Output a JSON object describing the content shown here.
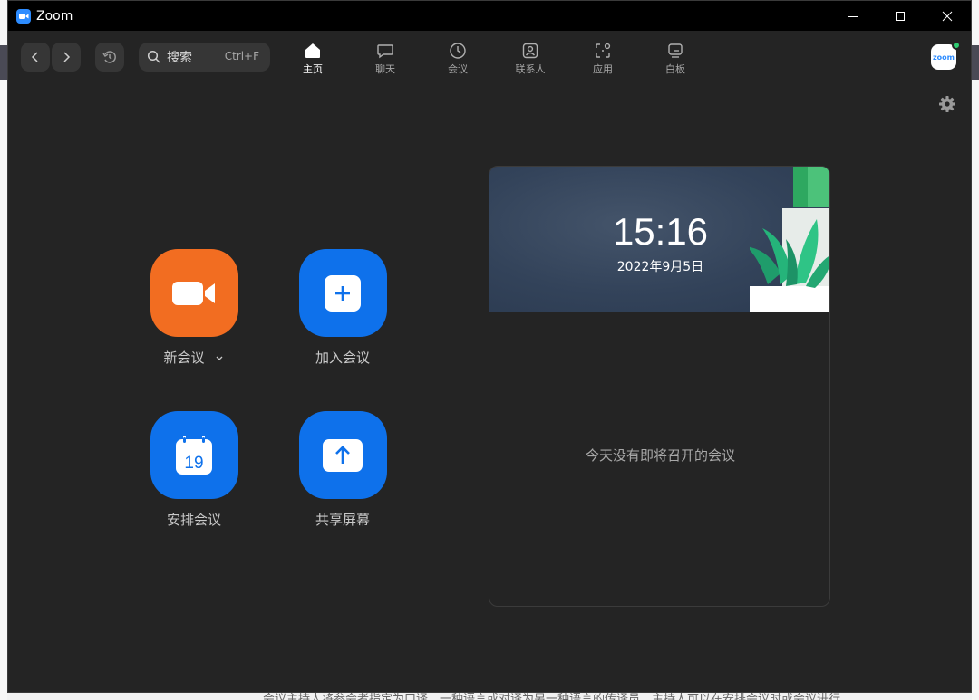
{
  "app": {
    "title": "Zoom"
  },
  "search": {
    "label": "搜索",
    "shortcut": "Ctrl+F"
  },
  "tabs": [
    {
      "label": "主页",
      "icon": "home-icon",
      "active": true
    },
    {
      "label": "聊天",
      "icon": "chat-icon",
      "active": false
    },
    {
      "label": "会议",
      "icon": "clock-icon",
      "active": false
    },
    {
      "label": "联系人",
      "icon": "contacts-icon",
      "active": false
    },
    {
      "label": "应用",
      "icon": "apps-icon",
      "active": false
    },
    {
      "label": "白板",
      "icon": "whiteboard-icon",
      "active": false
    }
  ],
  "avatar": {
    "text": "zoom",
    "status_color": "#2ecc71"
  },
  "actions": {
    "new_meeting": {
      "label": "新会议",
      "icon": "video-camera-icon",
      "color": "#f26d21"
    },
    "join_meeting": {
      "label": "加入会议",
      "icon": "plus-icon",
      "color": "#0e71eb"
    },
    "schedule": {
      "label": "安排会议",
      "icon": "calendar-icon",
      "day": "19",
      "color": "#0e71eb"
    },
    "share_screen": {
      "label": "共享屏幕",
      "icon": "upload-arrow-icon",
      "color": "#0e71eb"
    }
  },
  "card": {
    "time": "15:16",
    "date": "2022年9月5日",
    "empty_text": "今天没有即将召开的会议"
  },
  "background": {
    "bottom_text": "会议主持人将参会者指定为口译，一种语言或对译为另一种语言的传译员，主持人可以在安排会议时或会议进行"
  }
}
